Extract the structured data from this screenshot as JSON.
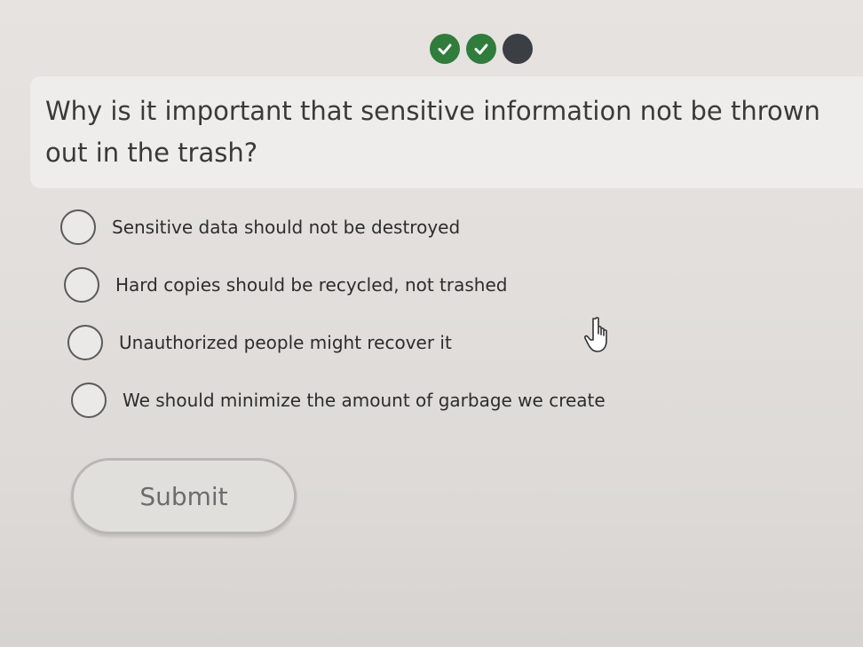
{
  "progress": {
    "steps": [
      {
        "state": "completed",
        "icon": "check-icon"
      },
      {
        "state": "completed",
        "icon": "check-icon"
      },
      {
        "state": "current",
        "icon": "dot-icon"
      }
    ]
  },
  "question": {
    "text": "Why is it important that sensitive information not be thrown out in the trash?"
  },
  "options": [
    {
      "label": "Sensitive data should not be destroyed",
      "selected": false
    },
    {
      "label": "Hard copies should be recycled, not trashed",
      "selected": false
    },
    {
      "label": "Unauthorized people might recover it",
      "selected": false
    },
    {
      "label": "We should minimize the amount of garbage we create",
      "selected": false
    }
  ],
  "submit": {
    "label": "Submit"
  },
  "colors": {
    "completed": "#2e7d3a",
    "current": "#3b3e42"
  },
  "pointer": {
    "icon": "hand-pointer-icon"
  }
}
